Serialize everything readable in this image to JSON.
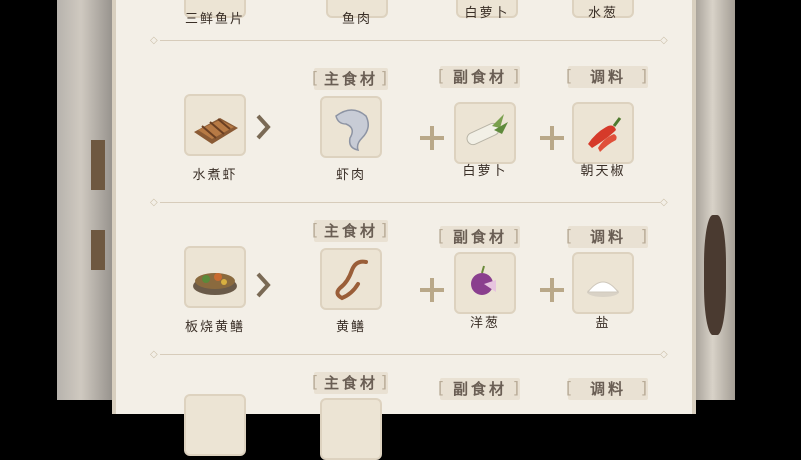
{
  "top_row": {
    "items": [
      {
        "label": "三鲜鱼片"
      },
      {
        "label": "鱼肉"
      },
      {
        "label": "白萝卜"
      },
      {
        "label": "水葱"
      }
    ]
  },
  "recipes": [
    {
      "dish": "水煮虾",
      "main_tag": "主食材",
      "main": "虾肉",
      "side_tag": "副食材",
      "side": "白萝卜",
      "seasoning_tag": "调料",
      "seasoning": "朝天椒"
    },
    {
      "dish": "板烧黄鳝",
      "main_tag": "主食材",
      "main": "黄鳝",
      "side_tag": "副食材",
      "side": "洋葱",
      "seasoning_tag": "调料",
      "seasoning": "盐"
    }
  ],
  "next_row": {
    "main_tag": "主食材",
    "side_tag": "副食材",
    "seasoning_tag": "调料"
  },
  "colors": {
    "panel": "#f3efe7",
    "tile": "#ece4d4",
    "text": "#3a2f27",
    "tag_text": "#6a5e54",
    "accent": "#b9a889"
  }
}
